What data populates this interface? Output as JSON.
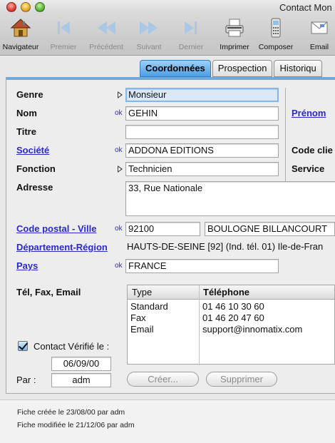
{
  "window": {
    "title": "Contact Mon"
  },
  "toolbar": {
    "items": [
      {
        "label": "Navigateur",
        "icon": "house-icon",
        "enabled": true
      },
      {
        "label": "Premier",
        "icon": "first-record-icon",
        "enabled": false
      },
      {
        "label": "Précédent",
        "icon": "previous-record-icon",
        "enabled": false
      },
      {
        "label": "Suivant",
        "icon": "next-record-icon",
        "enabled": false
      },
      {
        "label": "Dernier",
        "icon": "last-record-icon",
        "enabled": false
      },
      {
        "label": "Imprimer",
        "icon": "printer-icon",
        "enabled": true
      },
      {
        "label": "Composer",
        "icon": "phone-icon",
        "enabled": true
      },
      {
        "label": "Email",
        "icon": "email-icon",
        "enabled": true
      }
    ]
  },
  "tabs": [
    {
      "label": "Coordonnées",
      "active": true
    },
    {
      "label": "Prospection",
      "active": false
    },
    {
      "label": "Historiqu",
      "active": false
    }
  ],
  "form": {
    "genre": {
      "label": "Genre",
      "value": "Monsieur"
    },
    "nom": {
      "label": "Nom",
      "ok": "ok",
      "value": "GEHIN"
    },
    "prenom": {
      "label": "Prénom"
    },
    "titre": {
      "label": "Titre",
      "value": ""
    },
    "societe": {
      "label": "Société",
      "ok": "ok",
      "value": "ADDONA EDITIONS"
    },
    "code_client": {
      "label": "Code clie"
    },
    "fonction": {
      "label": "Fonction",
      "value": "Technicien"
    },
    "service": {
      "label": "Service"
    },
    "adresse": {
      "label": "Adresse",
      "value": "33, Rue Nationale"
    },
    "code_postal": {
      "label": "Code postal - Ville",
      "ok": "ok",
      "cp": "92100",
      "ville": "BOULOGNE BILLANCOURT"
    },
    "departement": {
      "label": "Département-Région",
      "value": "HAUTS-DE-SEINE [92] (Ind. tél. 01) Ile-de-Fran"
    },
    "pays": {
      "label": "Pays",
      "ok": "ok",
      "value": "FRANCE"
    },
    "tel_label": "Tél, Fax, Email",
    "phone_table": {
      "headers": [
        "Type",
        "Téléphone"
      ],
      "rows": [
        {
          "type": "Standard",
          "value": "01 46 10 30 60"
        },
        {
          "type": "Fax",
          "value": "01 46 20 47 60"
        },
        {
          "type": "Email",
          "value": "support@innomatix.com"
        }
      ]
    },
    "contact_verifie": {
      "label": "Contact Vérifié le :",
      "checked": true,
      "date": "06/09/00"
    },
    "par": {
      "label": "Par :",
      "value": "adm"
    },
    "buttons": {
      "creer": "Créer...",
      "supprimer": "Supprimer"
    }
  },
  "footer": {
    "created": "Fiche créée le 23/08/00 par adm",
    "modified": "Fiche modifiée le 21/12/06 par adm"
  },
  "colors": {
    "accent": "#4b9ee6",
    "link": "#2a2acc",
    "panel_top": "#6fa8dc"
  }
}
